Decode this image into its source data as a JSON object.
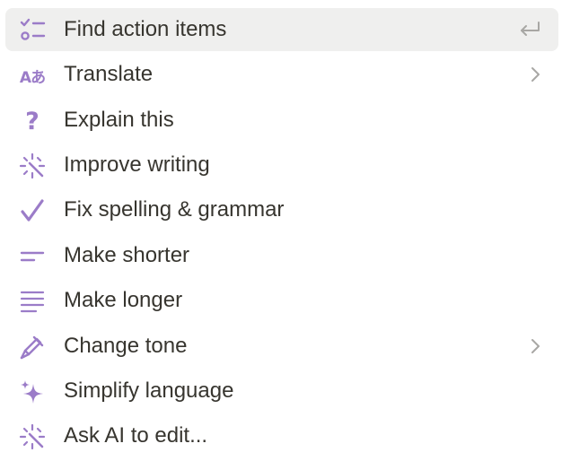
{
  "menu": {
    "items": [
      {
        "label": "Find action items",
        "icon": "checklist-icon",
        "trailing": "enter-icon",
        "highlighted": true
      },
      {
        "label": "Translate",
        "icon": "translate-icon",
        "trailing": "chevron-right-icon"
      },
      {
        "label": "Explain this",
        "icon": "question-icon"
      },
      {
        "label": "Improve writing",
        "icon": "sparkle-burst-icon"
      },
      {
        "label": "Fix spelling & grammar",
        "icon": "checkmark-icon"
      },
      {
        "label": "Make shorter",
        "icon": "short-lines-icon"
      },
      {
        "label": "Make longer",
        "icon": "long-lines-icon"
      },
      {
        "label": "Change tone",
        "icon": "pen-icon",
        "trailing": "chevron-right-icon"
      },
      {
        "label": "Simplify language",
        "icon": "sparkles-icon"
      },
      {
        "label": "Ask AI to edit...",
        "icon": "sparkle-burst-icon"
      }
    ],
    "translate_icon_text": "Aあ",
    "question_icon_text": "?"
  },
  "colors": {
    "icon_accent": "#9b7cc8",
    "label_text": "#37352f",
    "highlight_bg": "#efefee",
    "trailing_icon": "#a8a7a4"
  }
}
